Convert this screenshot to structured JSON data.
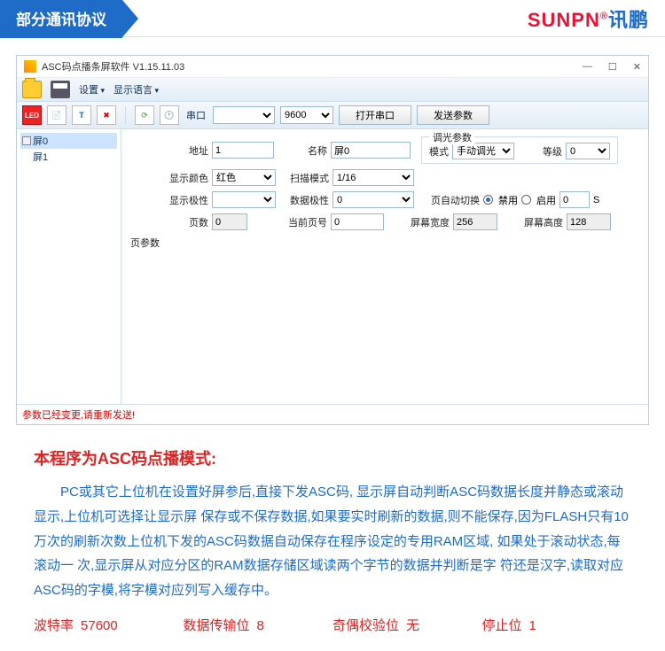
{
  "header": {
    "tab": "部分通讯协议",
    "brand_en": "SUNPN",
    "brand_cn": "讯鹏"
  },
  "window": {
    "title": "ASC码点播条屏软件 V1.15.11.03",
    "menu": {
      "settings": "设置",
      "language": "显示语言"
    },
    "toolbar": {
      "led": "LED",
      "port_label": "串口",
      "port_value": "",
      "baud_value": "9600",
      "open_port": "打开串口",
      "send_params": "发送参数"
    },
    "tree": {
      "root": "屏0",
      "child": "屏1"
    },
    "form": {
      "addr_label": "地址",
      "addr": "1",
      "name_label": "名称",
      "name": "屏0",
      "color_label": "显示颜色",
      "color": "红色",
      "scan_label": "扫描模式",
      "scan": "1/16",
      "dim_group": "调光参数",
      "mode_label": "模式",
      "mode": "手动调光",
      "level_label": "等级",
      "level": "0",
      "polarity_label": "显示极性",
      "polarity": "",
      "data_polarity_label": "数据极性",
      "data_polarity": "0",
      "auto_switch_label": "页自动切换",
      "auto_on": "启用",
      "auto_off": "禁用",
      "seconds": "0",
      "seconds_unit": "S",
      "pages_label": "页数",
      "pages": "0",
      "cur_page_label": "当前页号",
      "cur_page": "0",
      "width_label": "屏幕宽度",
      "width": "256",
      "height_label": "屏幕高度",
      "height": "128",
      "page_params": "页参数"
    },
    "status": "参数已经变更,请重新发送!"
  },
  "article": {
    "title": "本程序为ASC码点播模式:",
    "body": "PC或其它上位机在设置好屏参后,直接下发ASC码, 显示屏自动判断ASC码数据长度并静态或滚动显示,上位机可选择让显示屏 保存或不保存数据,如果要实时刷新的数据,则不能保存,因为FLASH只有10 万次的刷新次数上位机下发的ASC码数据自动保存在程序设定的专用RAM区域,  如果处于滚动状态,每滚动一 次,显示屏从对应分区的RAM数据存储区域读两个字节的数据并判断是字 符还是汉字,读取对应ASC码的字模,将字模对应列写入缓存中。"
  },
  "specs": {
    "baud_l": "波特率",
    "baud_v": "57600",
    "data_l": "数据传输位",
    "data_v": "8",
    "parity_l": "奇偶校验位",
    "parity_v": "无",
    "stop_l": "停止位",
    "stop_v": "1"
  }
}
